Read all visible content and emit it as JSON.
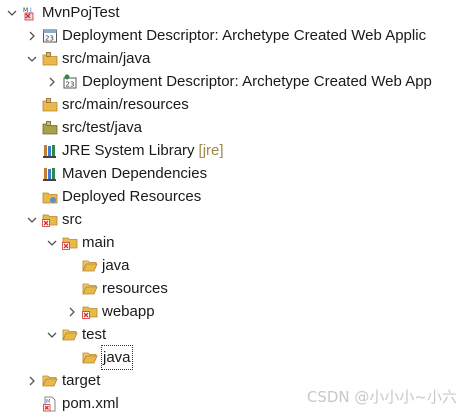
{
  "tree": {
    "project": "MvnPojTest",
    "deployment_descriptor": "Deployment Descriptor: Archetype Created Web Applic",
    "src_main_java": "src/main/java",
    "dd_child": "Deployment Descriptor: Archetype Created Web App",
    "src_main_resources": "src/main/resources",
    "src_test_java": "src/test/java",
    "jre_label": "JRE System Library",
    "jre_decoration": "[jre]",
    "maven_deps": "Maven Dependencies",
    "deployed_resources": "Deployed Resources",
    "src": "src",
    "main": "main",
    "java": "java",
    "resources": "resources",
    "webapp": "webapp",
    "test": "test",
    "test_java": "java",
    "target": "target",
    "pom": "pom.xml"
  },
  "watermark": "CSDN @小小小~小六",
  "colors": {
    "folder": "#e8b84a",
    "folder_dark": "#b8862a",
    "package_brown": "#a07a3a",
    "error_red": "#d32f2f",
    "jre_orange": "#c77d2e"
  }
}
